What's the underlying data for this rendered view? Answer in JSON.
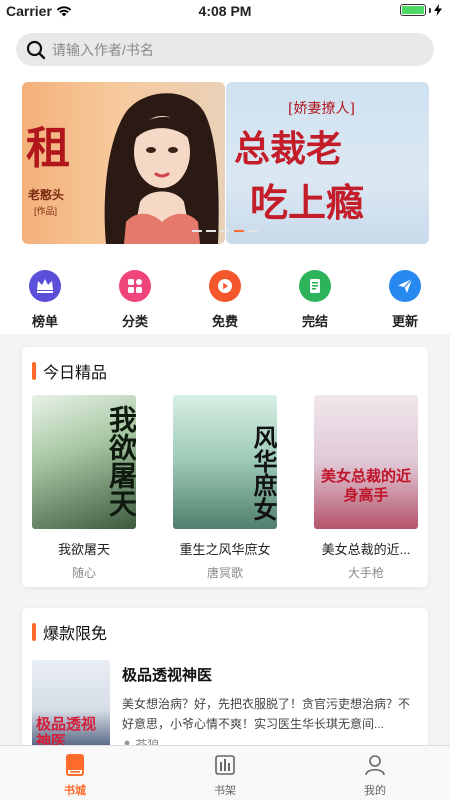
{
  "status_bar": {
    "carrier": "Carrier",
    "time": "4:08 PM"
  },
  "search": {
    "placeholder": "请输入作者/书名"
  },
  "banners": [
    {
      "title": "租",
      "subtitle": "老憨头",
      "note": "[作品]"
    },
    {
      "tag": "[娇妻撩人]",
      "line1": "总裁老",
      "line2": "吃上瘾"
    }
  ],
  "categories": [
    {
      "label": "榜单",
      "icon": "crown-icon",
      "color": "#5b4fd9"
    },
    {
      "label": "分类",
      "icon": "grid-icon",
      "color": "#f0457a"
    },
    {
      "label": "免费",
      "icon": "play-icon",
      "color": "#f5572d"
    },
    {
      "label": "完结",
      "icon": "document-icon",
      "color": "#2db35a"
    },
    {
      "label": "更新",
      "icon": "send-icon",
      "color": "#2788f0"
    }
  ],
  "today_picks": {
    "title": "今日精品",
    "books": [
      {
        "title": "我欲屠天",
        "author": "随心",
        "cover_text": "我欲屠天"
      },
      {
        "title": "重生之风华庶女",
        "author": "唐冥歌",
        "cover_text": "风华庶女"
      },
      {
        "title": "美女总裁的近...",
        "author": "大手枪",
        "cover_text": "美女总裁的近身高手"
      }
    ]
  },
  "hot_free": {
    "title": "爆款限免",
    "book": {
      "title": "极品透视神医",
      "description": "美女想治病？好，先把衣服脱了！贪官污吏想治病？不好意思，小爷心情不爽！实习医生华长琪无意间...",
      "author": "苍狼",
      "cover_text": "极品透视神医"
    }
  },
  "tabbar": {
    "tabs": [
      {
        "label": "书城",
        "icon": "book-icon",
        "active": true
      },
      {
        "label": "书架",
        "icon": "bookshelf-icon",
        "active": false
      },
      {
        "label": "我的",
        "icon": "user-icon",
        "active": false
      }
    ]
  },
  "colors": {
    "accent": "#ff6b2a",
    "battery": "#4cd964"
  }
}
